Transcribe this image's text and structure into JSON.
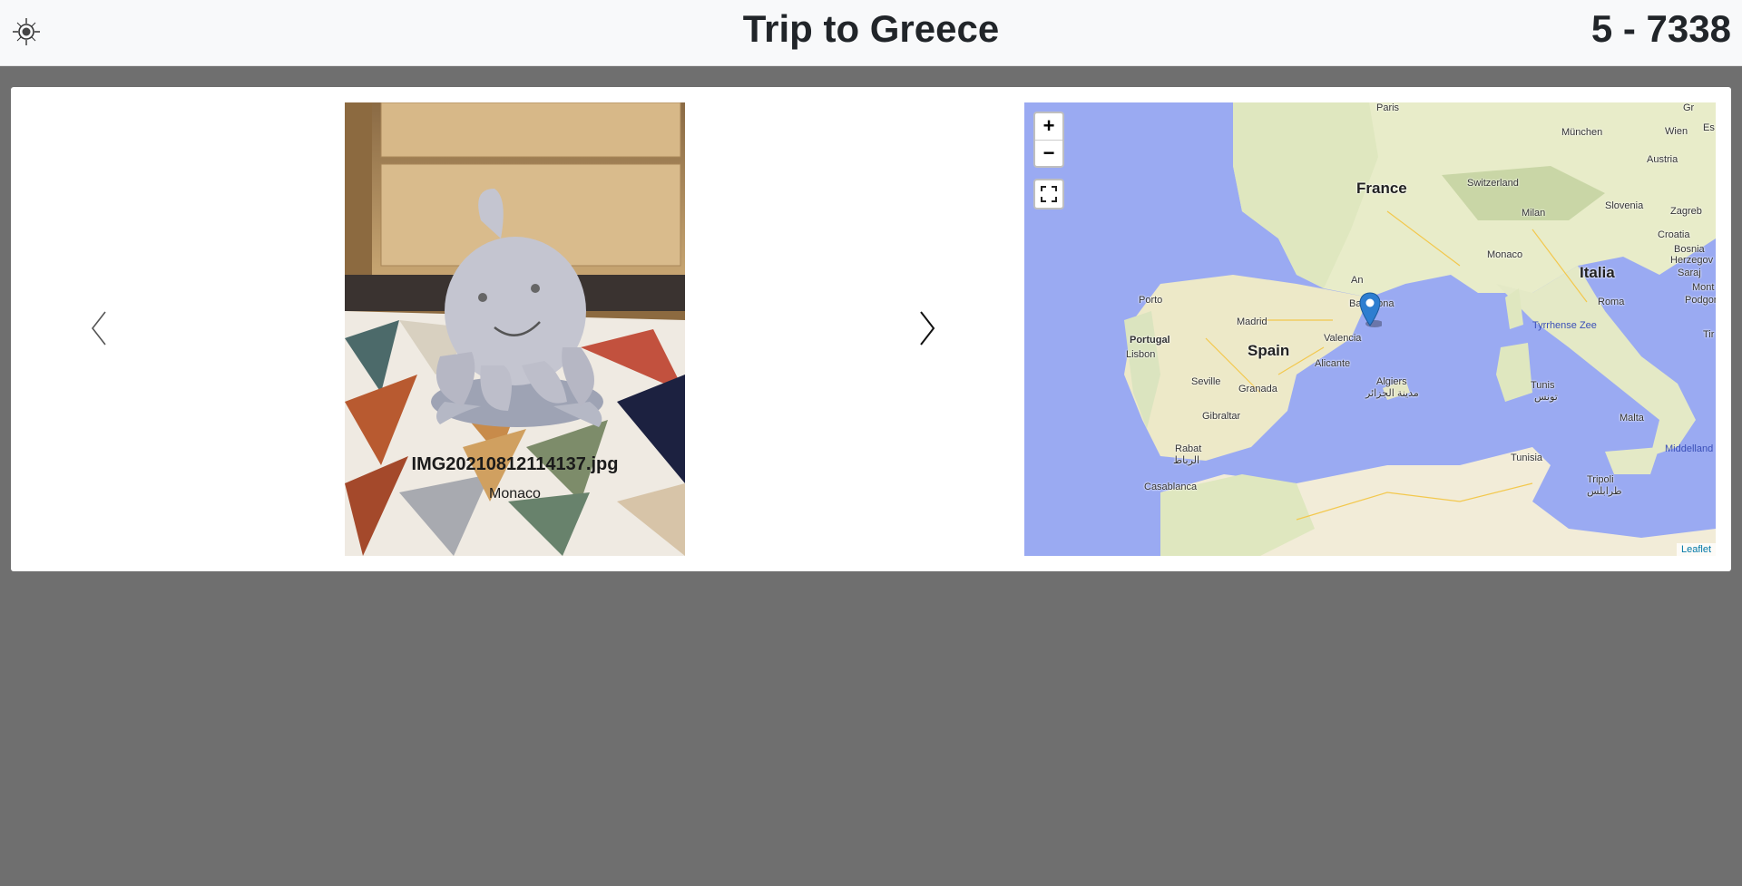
{
  "header": {
    "title": "Trip to Greece",
    "counter": "5 - 7338",
    "logo_icon": "compass-logo-icon"
  },
  "viewer": {
    "prev_icon": "chevron-left-icon",
    "next_icon": "chevron-right-icon",
    "photo": {
      "filename": "IMG20210812114137.jpg",
      "location": "Monaco"
    }
  },
  "map": {
    "zoom_in": "+",
    "zoom_out": "−",
    "fullscreen_icon": "fullscreen-icon",
    "marker_icon": "map-marker-icon",
    "attribution": "Leaflet",
    "labels": {
      "paris": "Paris",
      "munich": "München",
      "vienna": "Wien",
      "austria": "Austria",
      "france": "France",
      "switzerland": "Switzerland",
      "milan": "Milan",
      "slovenia": "Slovenia",
      "zagreb": "Zagreb",
      "croatia": "Croatia",
      "bosnia": "Bosnia",
      "herzegovina": "Herzegov",
      "monaco": "Monaco",
      "italia": "Italia",
      "rome": "Roma",
      "andorra": "An",
      "barcelona": "Barcelona",
      "porto": "Porto",
      "madrid": "Madrid",
      "spain": "Spain",
      "portugal": "Portugal",
      "lisbon": "Lisbon",
      "valencia": "Valencia",
      "alicante": "Alicante",
      "seville": "Seville",
      "granada": "Granada",
      "gibraltar": "Gibraltar",
      "algiers": "Algiers",
      "algiers_ar": "مدينة الجزائر",
      "tunis": "Tunis",
      "tunis_ar": "تونس",
      "tunisia": "Tunisia",
      "tyrrhenian": "Tyrrhense Zee",
      "malta": "Malta",
      "rabat": "Rabat",
      "rabat_ar": "الرباط",
      "casablanca": "Casablanca",
      "tripoli": "Tripoli",
      "tripoli_ar": "طرابلس",
      "middle_sea": "Middelland",
      "monte": "Mont",
      "podgorica": "Podgori",
      "sarajevo": "Saraj",
      "tirana": "Tir",
      "budapest_edge": "Gr",
      "es": "Es"
    }
  }
}
